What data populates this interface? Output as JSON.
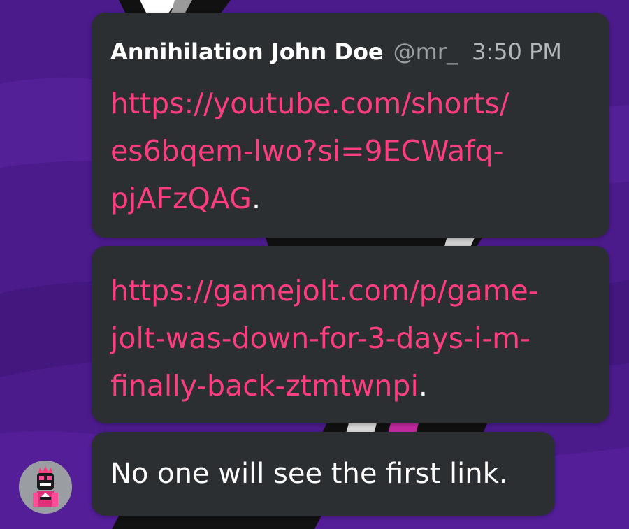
{
  "messages": [
    {
      "author": "Annihilation John Doe",
      "handle": "@mr_",
      "time": "3:50 PM",
      "link_text": "https://youtube.com/shorts/\nes6bqem-lwo?si=9ECWafq-\npjAFzQAG",
      "trailing": "."
    },
    {
      "link_text": "https://gamejolt.com/p/game-\njolt-was-down-for-3-days-i-m-\nfinally-back-ztmtwnpi",
      "trailing": "."
    },
    {
      "text": "No one will see the first link."
    }
  ],
  "avatar": {
    "icon": "robot-avatar-icon"
  },
  "colors": {
    "background": "#4a1a8a",
    "bubble": "#2b2f31",
    "link": "#ff3d7f",
    "text": "#ffffff",
    "muted": "#9b9fa3"
  }
}
